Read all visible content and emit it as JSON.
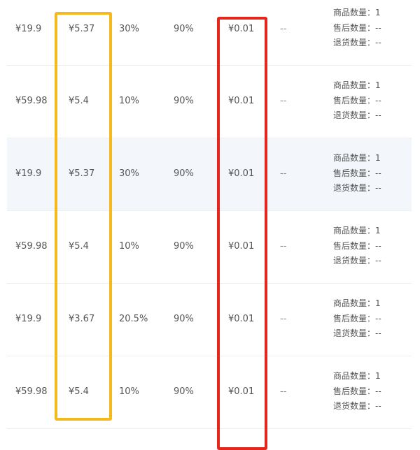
{
  "colors": {
    "yellow_box": "#f3b91d",
    "red_box": "#e5261c",
    "alt_row_bg": "#f3f6fb",
    "text": "#555555"
  },
  "rows": [
    {
      "price": "¥19.9",
      "cost": "¥5.37",
      "rate": "30%",
      "discount": "90%",
      "final_price": "¥0.01",
      "dash": "--",
      "stats": {
        "goods_count": "商品数量：1",
        "after_sales": "售后数量：--",
        "returns": "退货数量：--"
      }
    },
    {
      "price": "¥59.98",
      "cost": "¥5.4",
      "rate": "10%",
      "discount": "90%",
      "final_price": "¥0.01",
      "dash": "--",
      "stats": {
        "goods_count": "商品数量：1",
        "after_sales": "售后数量：--",
        "returns": "退货数量：--"
      }
    },
    {
      "price": "¥19.9",
      "cost": "¥5.37",
      "rate": "30%",
      "discount": "90%",
      "final_price": "¥0.01",
      "dash": "--",
      "stats": {
        "goods_count": "商品数量：1",
        "after_sales": "售后数量：--",
        "returns": "退货数量：--"
      }
    },
    {
      "price": "¥59.98",
      "cost": "¥5.4",
      "rate": "10%",
      "discount": "90%",
      "final_price": "¥0.01",
      "dash": "--",
      "stats": {
        "goods_count": "商品数量：1",
        "after_sales": "售后数量：--",
        "returns": "退货数量：--"
      }
    },
    {
      "price": "¥19.9",
      "cost": "¥3.67",
      "rate": "20.5%",
      "discount": "90%",
      "final_price": "¥0.01",
      "dash": "--",
      "stats": {
        "goods_count": "商品数量：1",
        "after_sales": "售后数量：--",
        "returns": "退货数量：--"
      }
    },
    {
      "price": "¥59.98",
      "cost": "¥5.4",
      "rate": "10%",
      "discount": "90%",
      "final_price": "¥0.01",
      "dash": "--",
      "stats": {
        "goods_count": "商品数量：1",
        "after_sales": "售后数量：--",
        "returns": "退货数量：--"
      }
    }
  ]
}
